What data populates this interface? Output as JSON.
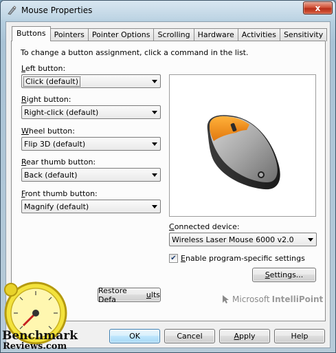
{
  "window": {
    "title": "Mouse Properties",
    "close_glyph": "x"
  },
  "tabs": [
    {
      "label": "Buttons",
      "active": true
    },
    {
      "label": "Pointers",
      "active": false
    },
    {
      "label": "Pointer Options",
      "active": false
    },
    {
      "label": "Scrolling",
      "active": false
    },
    {
      "label": "Hardware",
      "active": false
    },
    {
      "label": "Activities",
      "active": false
    },
    {
      "label": "Sensitivity",
      "active": false
    }
  ],
  "panel": {
    "instruction": "To change a button assignment, click a command in the list.",
    "fields": [
      {
        "accesskey": "L",
        "label_rest": "eft button:",
        "value": "Click (default)"
      },
      {
        "accesskey": "R",
        "label_rest": "ight button:",
        "value": "Right-click (default)"
      },
      {
        "accesskey": "W",
        "label_rest": "heel button:",
        "value": "Flip 3D (default)"
      },
      {
        "accesskey": "R",
        "label_rest": "ear thumb button:",
        "value": "Back (default)"
      },
      {
        "accesskey": "F",
        "label_rest": "ront thumb button:",
        "value": "Magnify (default)"
      }
    ],
    "connected_device": {
      "label_accesskey": "C",
      "label_rest": "onnected device:",
      "value": "Wireless Laser Mouse 6000 v2.0"
    },
    "program_specific": {
      "checked": true,
      "label_accesskey": "E",
      "label_rest": "nable program-specific settings"
    },
    "settings_button": {
      "pre": "",
      "accesskey": "S",
      "post": "ettings..."
    },
    "restore_button": {
      "pre": "Restore Defa",
      "accesskey": "u",
      "post": "lts"
    },
    "brand": {
      "prefix": "Microsoft",
      "product": "IntelliPoint"
    }
  },
  "footer": {
    "ok": "OK",
    "cancel": "Cancel",
    "apply_accesskey": "A",
    "apply_rest": "pply",
    "help": "Help"
  },
  "watermark": {
    "line1": "Benchmark",
    "line2": "Reviews.com"
  },
  "colors": {
    "mouse_accent": "#f5901e",
    "mouse_body": "#a8a8a8"
  }
}
